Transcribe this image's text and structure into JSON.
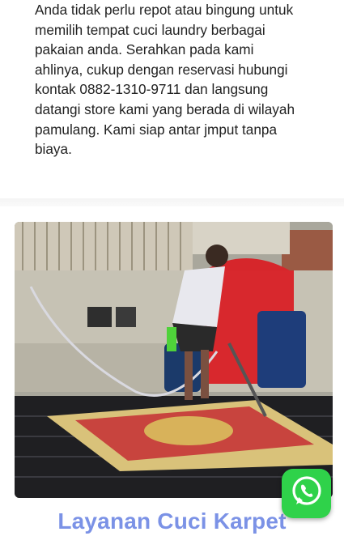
{
  "intro": {
    "text": "Anda tidak perlu repot atau bingung untuk memilih tempat cuci laundry berbagai pakaian anda. Serahkan pada kami ahlinya, cukup dengan reservasi hubungi kontak 0882-1310-9711 dan langsung datangi store kami yang berada di wilayah pamulang. Kami siap antar jmput tanpa biaya."
  },
  "service": {
    "title": "Layanan Cuci Karpet",
    "image_icon": "carpet-washing-photo"
  },
  "whatsapp": {
    "icon": "whatsapp-icon",
    "color": "#2fd24a"
  },
  "colors": {
    "title": "#7b92e6",
    "text": "#222222"
  }
}
